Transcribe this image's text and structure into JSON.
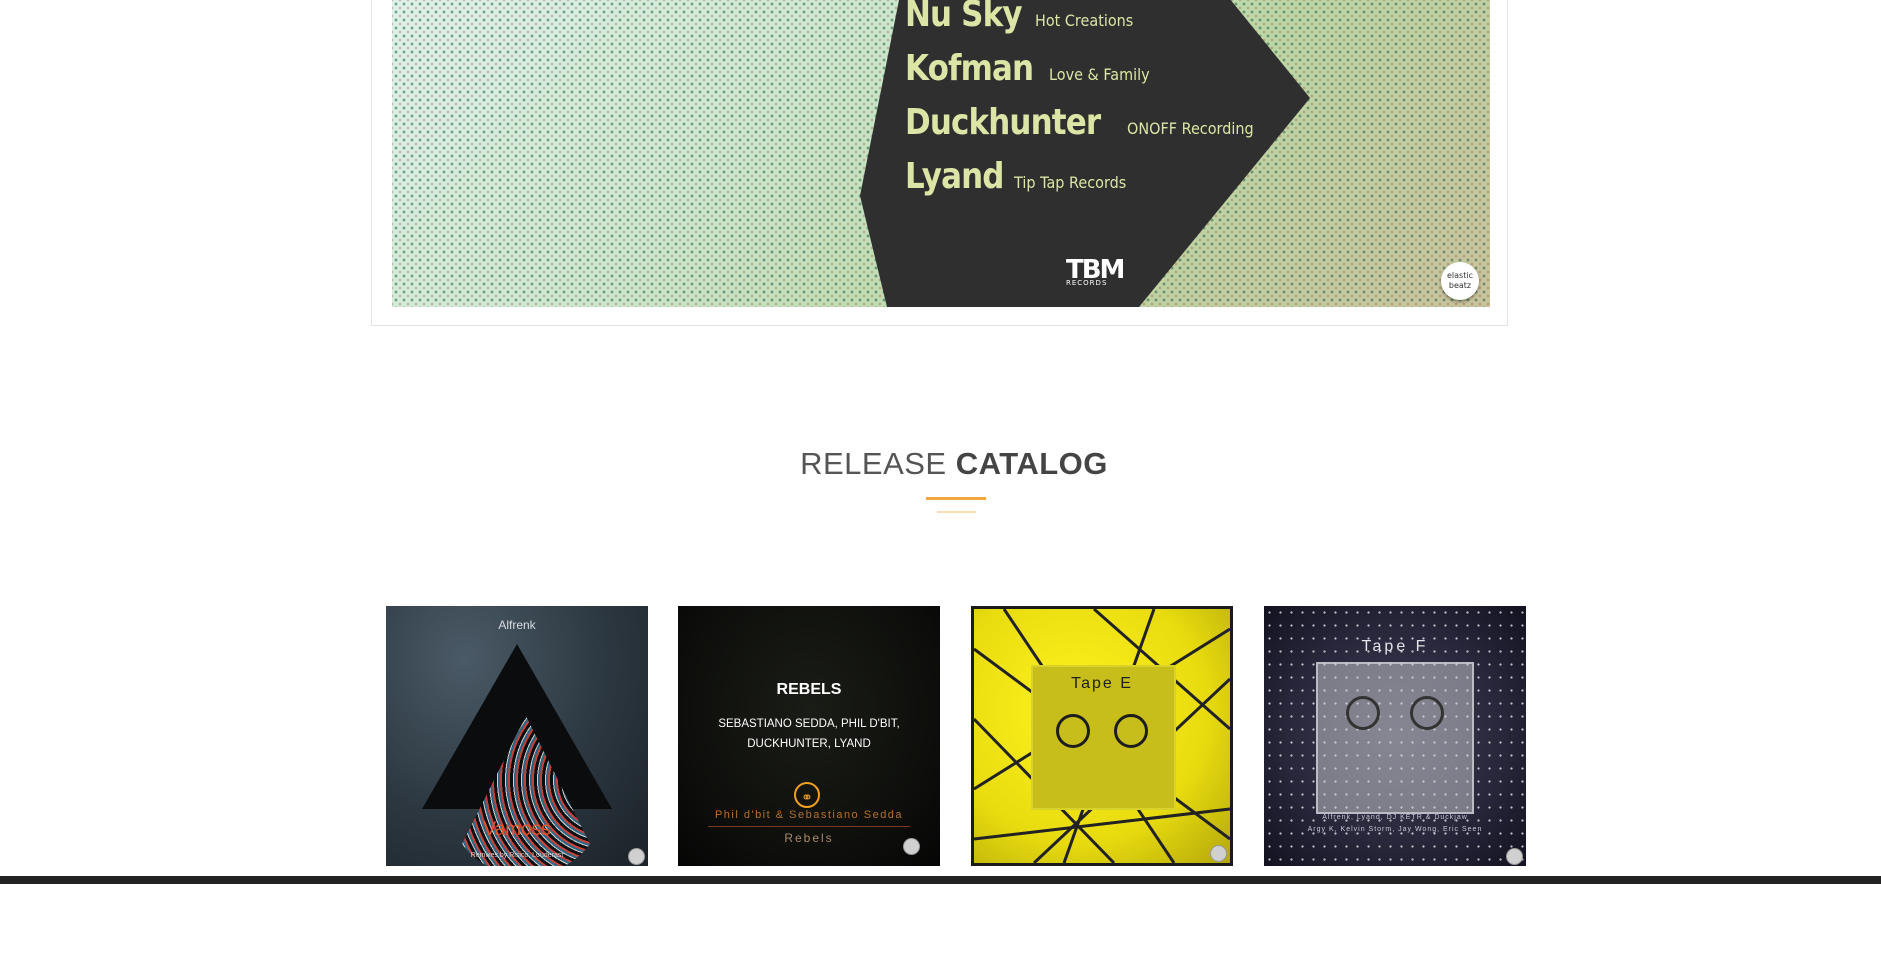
{
  "banner": {
    "artists": [
      {
        "name": "Nu Sky",
        "label": "Hot Creations"
      },
      {
        "name": "Kofman",
        "label": "Love & Family"
      },
      {
        "name": "Duckhunter",
        "label": "ONOFF Recording"
      },
      {
        "name": "Lyand",
        "label": "Tip Tap Records"
      }
    ],
    "left_logo": "TBM",
    "left_logo_sub": "RECORDS",
    "right_logo": "elastic beatz"
  },
  "section": {
    "title_light": "RELEASE",
    "title_bold": "CATALOG",
    "accent_color": "#f0a83c"
  },
  "releases": [
    {
      "artist": "Alfrenk",
      "title": "Vamoss",
      "sub": "Remixes by Risico, Louderast"
    },
    {
      "title": "REBELS",
      "artists": "SEBASTIANO SEDDA, PHIL D'BIT, DUCKHUNTER, LYAND",
      "credit": "Phil d'bit & Sebastiano Sedda",
      "subtitle": "Rebels"
    },
    {
      "title": "Tape E"
    },
    {
      "title": "Tape F",
      "artists_line1": "Alfrenk, Lyand, DJ KETR & Duckjaw",
      "artists_line2": "Argy K, Kelvin Storm, Jay Wong, Eric Seen"
    }
  ]
}
